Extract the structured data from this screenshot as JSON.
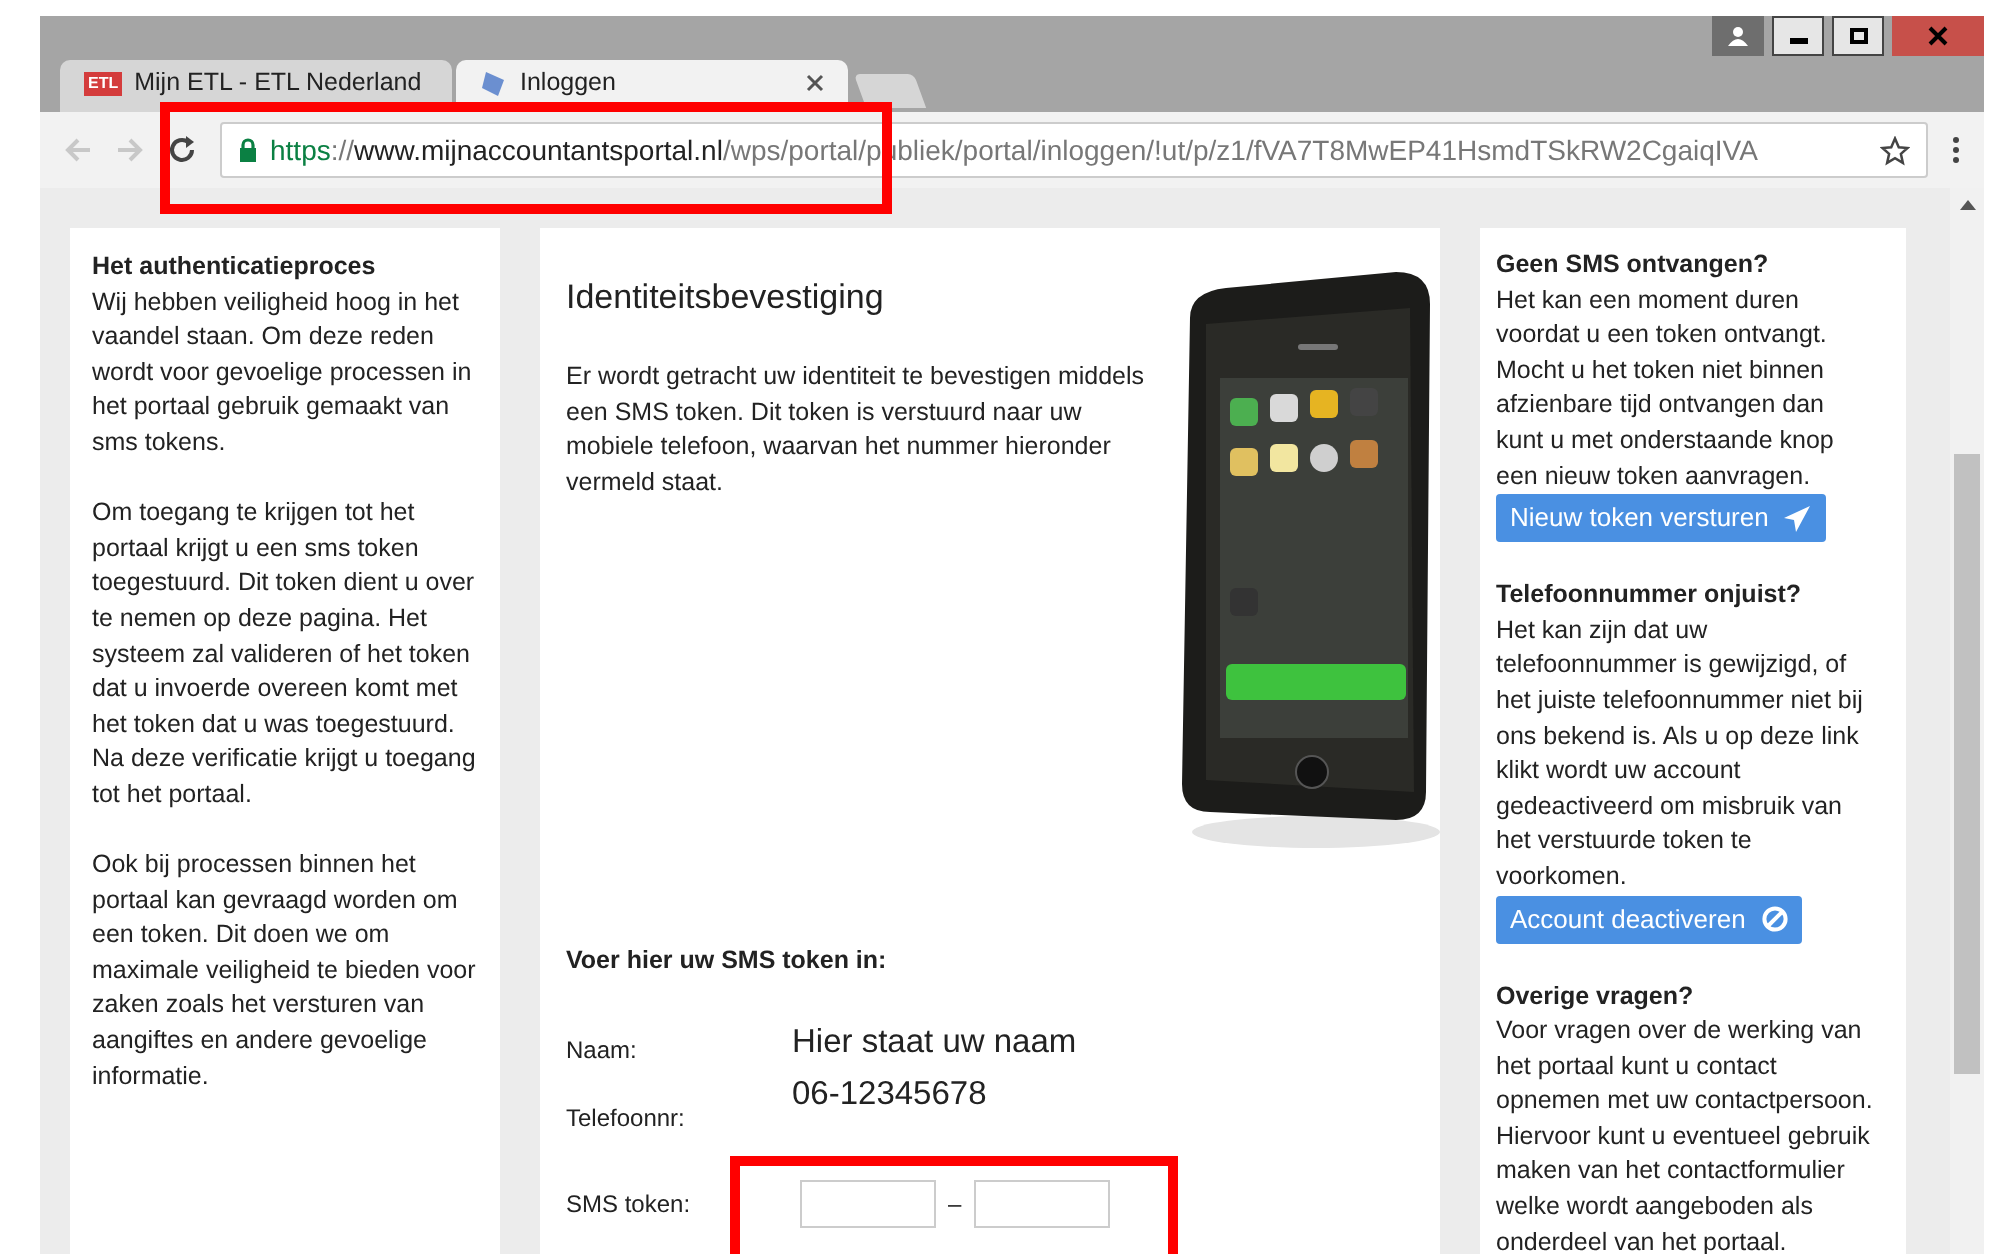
{
  "tabs": [
    {
      "label": "Mijn ETL - ETL Nederland",
      "favicon_text": "ETL",
      "selected": false
    },
    {
      "label": "Inloggen",
      "selected": true
    }
  ],
  "address": {
    "scheme": "https",
    "separator": "://",
    "host": "www.mijnaccountantsportal.nl",
    "path": "/wps/portal/publiek/portal/inloggen/!ut/p/z1/fVA7T8MwEP41HsmdTSkRW2CgaiqIVA",
    "secure": true
  },
  "left_panel": {
    "title": "Het authenticatieproces",
    "paragraphs": [
      "Wij hebben veiligheid hoog in het vaandel staan. Om deze reden wordt voor gevoelige processen in het portaal gebruik gemaakt van sms tokens.",
      "Om toegang te krijgen tot het portaal krijgt u een sms token toegestuurd. Dit token dient u over te nemen op deze pagina. Het systeem zal valideren of het token dat u invoerde overeen komt met het token dat u was toegestuurd. Na deze verificatie krijgt u toegang tot het portaal.",
      "Ook bij processen binnen het portaal kan gevraagd worden om een token. Dit doen we om maximale veiligheid te bieden voor zaken zoals het versturen van aangiftes en andere gevoelige informatie."
    ]
  },
  "main_panel": {
    "heading": "Identiteitsbevestiging",
    "intro": "Er wordt getracht uw identiteit te bevestigen middels een SMS token. Dit token is verstuurd naar uw mobiele telefoon, waarvan het nummer hieronder vermeld staat.",
    "form_title": "Voer hier uw SMS token in:",
    "name_label": "Naam:",
    "name_value": "Hier staat uw naam",
    "phone_label": "Telefoonnr:",
    "phone_value": "06-12345678",
    "token_label": "SMS token:",
    "token_separator": "–"
  },
  "right_panel": [
    {
      "title": "Geen SMS ontvangen?",
      "text": "Het kan een moment duren voordat u een token ontvangt. Mocht u het token niet binnen afzienbare tijd ontvangen dan kunt u met onderstaande knop een nieuw token aanvragen.",
      "button": {
        "label": "Nieuw token versturen",
        "kind": "send"
      }
    },
    {
      "title": "Telefoonnummer onjuist?",
      "text": "Het kan zijn dat uw telefoonnummer is gewijzigd, of het juiste telefoonnummer niet bij ons bekend is. Als u op deze link klikt wordt uw account gedeactiveerd om misbruik van het verstuurde token te voorkomen.",
      "button": {
        "label": "Account deactiveren",
        "kind": "ban"
      }
    },
    {
      "title": "Overige vragen?",
      "text": "Voor vragen over de werking van het portaal kunt u contact opnemen met uw contactpersoon. Hiervoor kunt u eventueel gebruik maken van het contactformulier welke wordt aangeboden als onderdeel van het portaal."
    }
  ],
  "highlights": {
    "address_bar": true,
    "token_fields": true
  }
}
